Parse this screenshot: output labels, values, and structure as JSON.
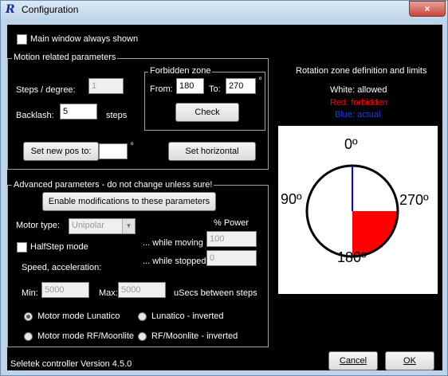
{
  "window": {
    "title": "Configuration",
    "close_glyph": "×"
  },
  "main_window_always_shown": {
    "label": "Main window always shown",
    "checked": false
  },
  "motion": {
    "legend": "Motion related parameters",
    "steps_label": "Steps / degree:",
    "steps_value": "1",
    "backlash_label": "Backlash:",
    "backlash_value": "5",
    "backlash_unit": "steps",
    "set_new_pos_label": "Set new pos to:",
    "new_pos_value": "",
    "degree_symbol": "º",
    "set_horizontal_label": "Set horizontal",
    "forbidden": {
      "legend": "Forbidden zone",
      "from_label": "From:",
      "from_value": "180",
      "to_label": "To:",
      "to_value": "270",
      "degree_symbol": "º",
      "check_label": "Check"
    }
  },
  "rotation": {
    "title": "Rotation zone definition and limits",
    "allowed_text": "White: allowed",
    "forbidden_text": "Red: forbidden",
    "actual_text": "Blue: actual",
    "colors": {
      "allowed": "#ffffff",
      "forbidden": "#ff0000",
      "actual": "#0000ff"
    },
    "label_top": "0º",
    "label_left": "90º",
    "label_right": "270º",
    "label_bottom": "180º"
  },
  "advanced": {
    "legend": "Advanced parameters - do not change unless sure!",
    "enable_label": "Enable modifications to these parameters",
    "motor_type_label": "Motor type:",
    "motor_type_value": "Unipolar",
    "power_header": "% Power",
    "halfstep_label": "HalfStep mode",
    "halfstep_checked": false,
    "while_moving_label": "... while moving",
    "while_moving_value": "100",
    "while_stopped_label": "... while stopped",
    "while_stopped_value": "0",
    "speed_label": "Speed, acceleration:",
    "min_label": "Min:",
    "min_value": "5000",
    "max_label": "Max:",
    "max_value": "5000",
    "usecs_label": "uSecs between steps",
    "radios": [
      {
        "label": "Motor mode Lunatico",
        "selected": true
      },
      {
        "label": "Lunatico - inverted",
        "selected": false
      },
      {
        "label": "Motor mode RF/Moonlite",
        "selected": false
      },
      {
        "label": "RF/Moonlite - inverted",
        "selected": false
      }
    ]
  },
  "footer": {
    "version": "Seletek controller Version 4.5.0",
    "cancel_label": "Cancel",
    "ok_label": "OK"
  }
}
